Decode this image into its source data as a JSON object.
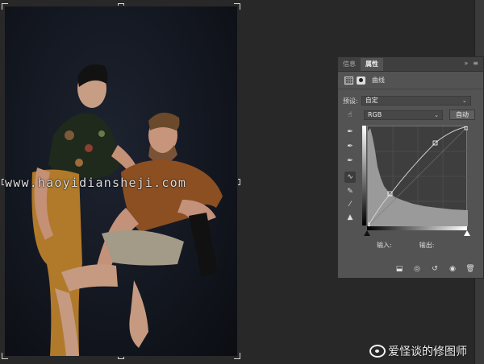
{
  "panel": {
    "tabs": [
      {
        "label": "信息",
        "active": false
      },
      {
        "label": "属性",
        "active": true
      }
    ],
    "tab_controls": {
      "collapse": "»",
      "menu": "≡"
    },
    "adjustment_title": "曲线",
    "preset_label": "预设:",
    "preset_value": "自定",
    "channel_value": "RGB",
    "auto_label": "自动",
    "input_label": "输入:",
    "output_label": "输出:"
  },
  "watermark": {
    "text": "www.haoyidiansheji.com"
  },
  "weibo": {
    "text": "爱怪谈的修图师"
  },
  "colors": {
    "panel_bg": "#535353",
    "workspace_bg": "#282828",
    "curve_line": "#c8c8c8"
  },
  "icons": {
    "tools": [
      "target-adjust-icon",
      "black-eyedropper-icon",
      "gray-eyedropper-icon",
      "white-eyedropper-icon",
      "curve-points-icon",
      "pencil-icon",
      "smooth-icon",
      "clipping-warning-icon"
    ],
    "bottom": [
      "clip-to-layer-icon",
      "view-previous-icon",
      "reset-icon",
      "visibility-icon",
      "trash-icon"
    ]
  }
}
